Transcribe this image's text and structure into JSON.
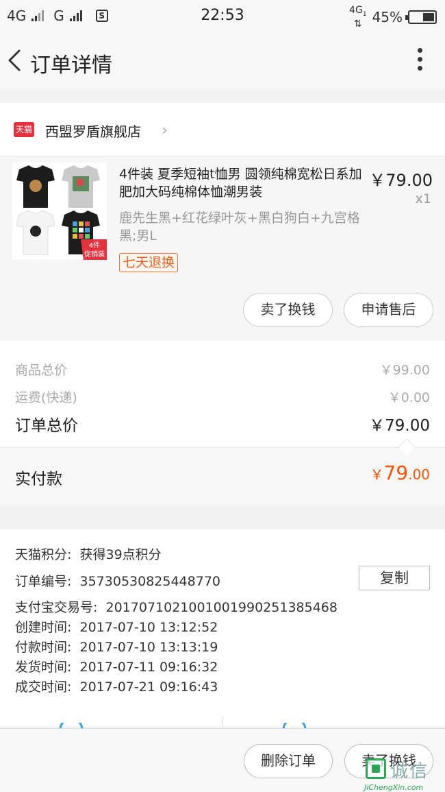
{
  "status_bar": {
    "net1": "4G",
    "net2": "G",
    "sim_icon": "S",
    "time": "22:53",
    "data_type": "4G",
    "data_sub": "1",
    "battery": "45%",
    "battery_level": 0.45
  },
  "header": {
    "title": "订单详情",
    "back_icon": "chevron-left-icon",
    "more_icon": "vertical-dots-icon"
  },
  "shop": {
    "badge": "天猫",
    "name": "西盟罗盾旗舰店",
    "chevron": "›",
    "badge_color": "#e5323e"
  },
  "product": {
    "title": "4件装 夏季短袖t恤男 圆领纯棉宽松日系加肥加大码纯棉体恤潮男装",
    "price": "￥79.00",
    "quantity": "x1",
    "variant": "鹿先生黑+红花绿叶灰+黑白狗白+九宫格黑;男L",
    "return_badge": "七天退换",
    "image_tag": "4件\n促销装",
    "image_tag_line1": "4件",
    "image_tag_line2": "促销装",
    "buttons": {
      "sell": "卖了换钱",
      "after_sale": "申请售后"
    }
  },
  "summary": {
    "goods_total_label": "商品总价",
    "goods_total_value": "￥99.00",
    "shipping_label": "运费(快递)",
    "shipping_value": "￥0.00",
    "order_total_label": "订单总价",
    "order_total_value": "￥79.00",
    "paid_label": "实付款",
    "paid_currency": "￥",
    "paid_int": "79",
    "paid_dec": ".00",
    "paid_color": "#ff5000"
  },
  "info": {
    "points_label": "天猫积分:",
    "points_value": "获得39点积分",
    "order_no_label": "订单编号:",
    "order_no_value": "357305308254487 70",
    "copy_button": "复制",
    "alipay_label": "支付宝交易号:",
    "alipay_value": "2017071021001001990251385468",
    "created_label": "创建时间:",
    "created_value": "2017-07-10 13:12:52",
    "paid_time_label": "付款时间:",
    "paid_time_value": "2017-07-10 13:13:19",
    "shipped_label": "发货时间:",
    "shipped_value": "2017-07-11 09:16:32",
    "completed_label": "成交时间:",
    "completed_value": "2017-07-21 09:16:43"
  },
  "bottom_bar": {
    "delete_order": "删除订单",
    "sell": "卖了换钱"
  },
  "watermark": {
    "cn": "诚信",
    "url": "JiChengXin.com"
  }
}
